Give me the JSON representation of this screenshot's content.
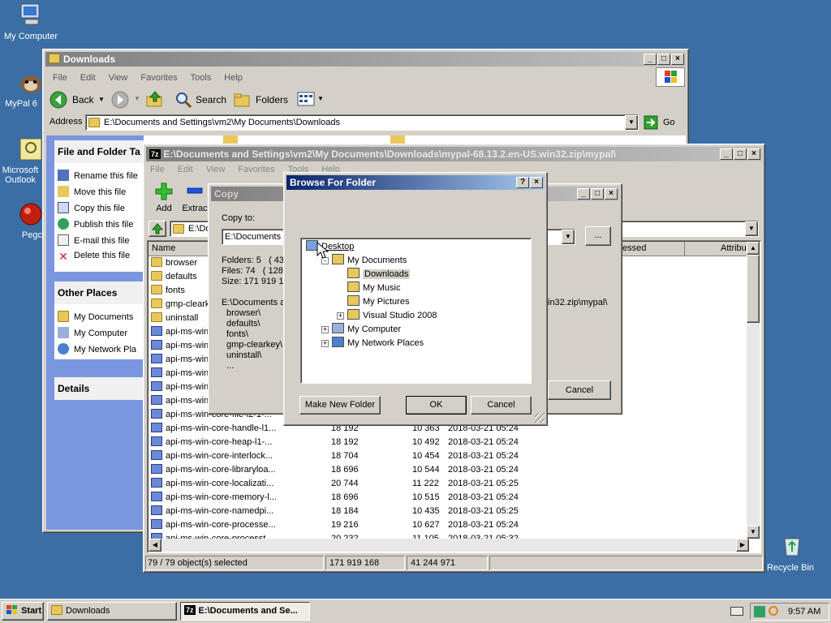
{
  "desktop": {
    "icons": [
      {
        "label": "My Computer"
      },
      {
        "label": "MyPal 6"
      },
      {
        "label": "Microsoft Outlook"
      },
      {
        "label": "Pegc"
      },
      {
        "label": "Recycle Bin"
      }
    ]
  },
  "explorer": {
    "title": "Downloads",
    "menu": [
      "File",
      "Edit",
      "View",
      "Favorites",
      "Tools",
      "Help"
    ],
    "toolbar": {
      "back": "Back",
      "search": "Search",
      "folders": "Folders"
    },
    "address_label": "Address",
    "address_value": "E:\\Documents and Settings\\vm2\\My Documents\\Downloads",
    "go_label": "Go",
    "tasks_header": "File and Folder Ta",
    "tasks": [
      "Rename this file",
      "Move this file",
      "Copy this file",
      "Publish this file",
      "E-mail this file",
      "Delete this file"
    ],
    "other_header": "Other Places",
    "other": [
      "My Documents",
      "My Computer",
      "My Network Pla"
    ],
    "details_header": "Details"
  },
  "sevenzip": {
    "title": "E:\\Documents and Settings\\vm2\\My Documents\\Downloads\\mypal-68.13.2.en-US.win32.zip\\mypal\\",
    "menu": [
      "File",
      "Edit",
      "View",
      "Favorites",
      "Tools",
      "Help"
    ],
    "add_label": "Add",
    "extract_label": "Extrac",
    "path_value": "E:\\Do",
    "col_name": "Name",
    "col_accessed": "essed",
    "col_attrib": "Attribu",
    "rows": [
      {
        "name": "browser",
        "type": "folder",
        "size": "",
        "packed": "",
        "date": ""
      },
      {
        "name": "defaults",
        "type": "folder",
        "size": "",
        "packed": "",
        "date": ""
      },
      {
        "name": "fonts",
        "type": "folder",
        "size": "",
        "packed": "",
        "date": ""
      },
      {
        "name": "gmp-clearke",
        "type": "folder",
        "size": "",
        "packed": "",
        "date": ""
      },
      {
        "name": "uninstall",
        "type": "folder",
        "size": "",
        "packed": "",
        "date": ""
      },
      {
        "name": "api-ms-win-",
        "type": "dll",
        "size": "",
        "packed": "",
        "date": ""
      },
      {
        "name": "api-ms-win-",
        "type": "dll",
        "size": "",
        "packed": "",
        "date": ""
      },
      {
        "name": "api-ms-win-",
        "type": "dll",
        "size": "",
        "packed": "",
        "date": ""
      },
      {
        "name": "api-ms-win-",
        "type": "dll",
        "size": "",
        "packed": "",
        "date": ""
      },
      {
        "name": "api-ms-win-",
        "type": "dll",
        "size": "",
        "packed": "",
        "date": ""
      },
      {
        "name": "api-ms-win-",
        "type": "dll",
        "size": "",
        "packed": "",
        "date": ""
      },
      {
        "name": "api-ms-win-core-file-l2-1-...",
        "type": "dll",
        "size": "",
        "packed": "",
        "date": ""
      },
      {
        "name": "api-ms-win-core-handle-l1...",
        "type": "dll",
        "size": "18 192",
        "packed": "10 363",
        "date": "2018-03-21 05:24"
      },
      {
        "name": "api-ms-win-core-heap-l1-...",
        "type": "dll",
        "size": "18 192",
        "packed": "10 492",
        "date": "2018-03-21 05:24"
      },
      {
        "name": "api-ms-win-core-interlock...",
        "type": "dll",
        "size": "18 704",
        "packed": "10 454",
        "date": "2018-03-21 05:24"
      },
      {
        "name": "api-ms-win-core-libraryloa...",
        "type": "dll",
        "size": "18 696",
        "packed": "10 544",
        "date": "2018-03-21 05:24"
      },
      {
        "name": "api-ms-win-core-localizati...",
        "type": "dll",
        "size": "20 744",
        "packed": "11 222",
        "date": "2018-03-21 05:25"
      },
      {
        "name": "api-ms-win-core-memory-l...",
        "type": "dll",
        "size": "18 696",
        "packed": "10 515",
        "date": "2018-03-21 05:24"
      },
      {
        "name": "api-ms-win-core-namedpi...",
        "type": "dll",
        "size": "18 184",
        "packed": "10 435",
        "date": "2018-03-21 05:25"
      },
      {
        "name": "api-ms-win-core-processe...",
        "type": "dll",
        "size": "19 216",
        "packed": "10 627",
        "date": "2018-03-21 05:24"
      },
      {
        "name": "api-ms-win-core-processt...",
        "type": "dll",
        "size": "20 232",
        "packed": "11 105",
        "date": "2018-03-21 05:32"
      }
    ],
    "status_selected": "79 / 79 object(s) selected",
    "status_size": "171 919 168",
    "status_packed": "41 244 971"
  },
  "copy": {
    "title": "Copy",
    "copy_to_label": "Copy to:",
    "copy_to_value": "E:\\Documents a",
    "folders": "Folders: 5   ( 43",
    "files": "Files: 74   ( 128",
    "size": "Size: 171 919 16",
    "source_path": "E:\\Documents a",
    "source_tail": "in32.zip\\mypal\\",
    "items": [
      "browser\\",
      "defaults\\",
      "fonts\\",
      "gmp-clearkey\\",
      "uninstall\\",
      "..."
    ],
    "browse_label": "...",
    "cancel_label": "Cancel"
  },
  "browse": {
    "title": "Browse For Folder",
    "help_label": "?",
    "tree": [
      {
        "label": "Desktop",
        "level": 0,
        "expander": "",
        "icon": "desktop"
      },
      {
        "label": "My Documents",
        "level": 1,
        "expander": "-",
        "icon": "folder-open"
      },
      {
        "label": "Downloads",
        "level": 2,
        "expander": "",
        "icon": "folder",
        "selected": true
      },
      {
        "label": "My Music",
        "level": 2,
        "expander": "",
        "icon": "folder-music"
      },
      {
        "label": "My Pictures",
        "level": 2,
        "expander": "",
        "icon": "folder-pictures"
      },
      {
        "label": "Visual Studio 2008",
        "level": 2,
        "expander": "+",
        "icon": "folder"
      },
      {
        "label": "My Computer",
        "level": 1,
        "expander": "+",
        "icon": "computer"
      },
      {
        "label": "My Network Places",
        "level": 1,
        "expander": "+",
        "icon": "network"
      }
    ],
    "make_folder_label": "Make New Folder",
    "ok_label": "OK",
    "cancel_label": "Cancel"
  },
  "taskbar": {
    "start_label": "Start",
    "tasks": [
      "Downloads",
      "E:\\Documents and Se..."
    ],
    "clock": "9:57 AM"
  }
}
